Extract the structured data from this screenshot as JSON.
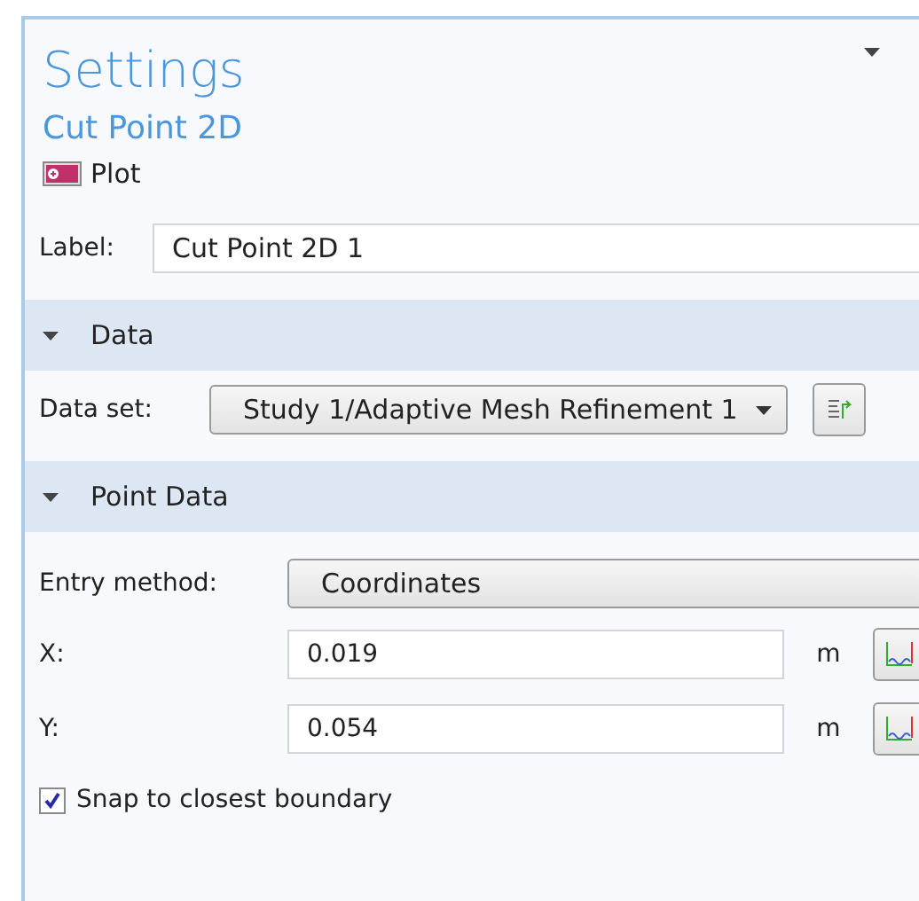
{
  "panel": {
    "title": "Settings",
    "subtitle": "Cut Point 2D",
    "toolbar_button": "Plot"
  },
  "label_field": {
    "label": "Label:",
    "value": "Cut Point 2D 1"
  },
  "sections": [
    {
      "title": "Data",
      "expanded": true,
      "rows": [
        {
          "kind": "combo",
          "label": "Data set:",
          "value": "Study 1/Adaptive Mesh Refinement 1"
        }
      ]
    },
    {
      "title": "Point Data",
      "expanded": true,
      "rows": [
        {
          "kind": "combo",
          "label": "Entry method:",
          "value": "Coordinates"
        },
        {
          "kind": "number",
          "label": "X:",
          "value": "0.019",
          "unit": "m"
        },
        {
          "kind": "number",
          "label": "Y:",
          "value": "0.054",
          "unit": "m"
        },
        {
          "kind": "checkbox",
          "label": "Snap to closest boundary",
          "checked": true
        }
      ]
    }
  ]
}
